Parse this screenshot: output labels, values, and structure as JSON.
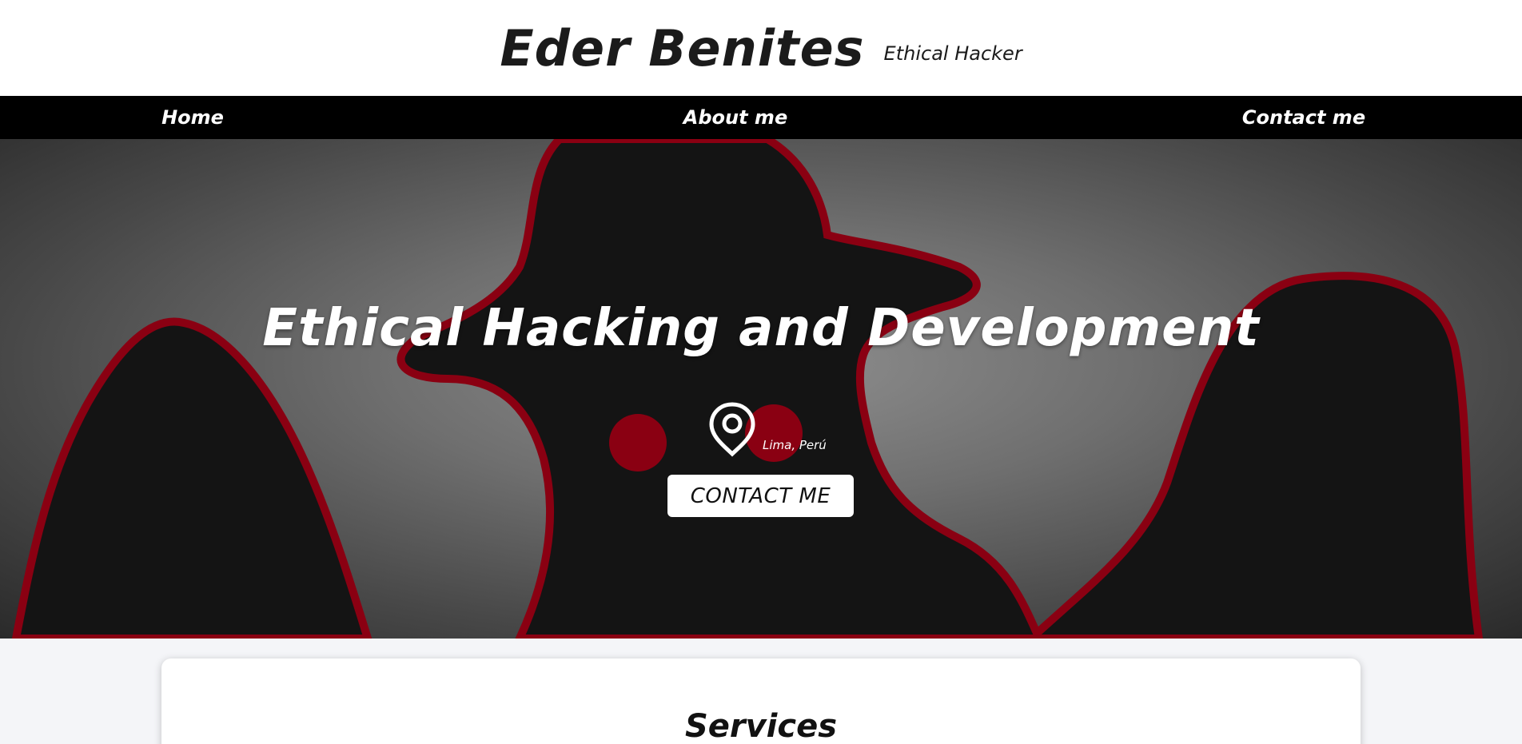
{
  "header": {
    "name": "Eder Benites",
    "tagline": "Ethical Hacker"
  },
  "nav": {
    "items": [
      {
        "label": "Home"
      },
      {
        "label": "About me"
      },
      {
        "label": "Contact me"
      }
    ]
  },
  "hero": {
    "title": "Ethical Hacking and Development",
    "location": "Lima, Perú",
    "location_icon": "map-pin-icon",
    "cta_label": "CONTACT ME"
  },
  "services": {
    "title": "Services"
  },
  "colors": {
    "accent_red": "#8a0012",
    "nav_background": "#000000",
    "silhouette": "#141414"
  }
}
